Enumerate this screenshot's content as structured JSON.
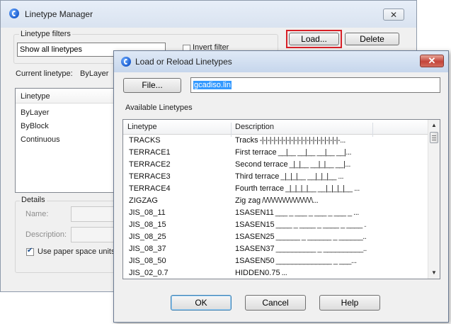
{
  "manager": {
    "title": "Linetype Manager",
    "close_glyph": "✕",
    "filters_label": "Linetype filters",
    "filter_value": "Show all linetypes",
    "invert_label": "Invert filter",
    "load_label": "Load...",
    "delete_label": "Delete",
    "current_label": "Current linetype:",
    "current_value": "ByLayer",
    "list_header": "Linetype",
    "list_items": [
      "ByLayer",
      "ByBlock",
      "Continuous"
    ],
    "details_label": "Details",
    "name_label": "Name:",
    "description_label": "Description:",
    "paper_space_label": "Use paper space units"
  },
  "dialog": {
    "title": "Load or Reload Linetypes",
    "close_glyph": "✕",
    "file_button": "File...",
    "file_value": "gcadiso.lin",
    "available_label": "Available Linetypes",
    "col_linetype": "Linetype",
    "col_description": "Description",
    "rows": [
      {
        "name": "TRACKS",
        "desc": "Tracks",
        "sample": "-|-|-|-|-|-|-|-|-|-|-|-|-|-|-|-|-|-|-|-|-..."
      },
      {
        "name": "TERRACE1",
        "desc": "First terrace",
        "sample": "__|__  __|__  __|__  __|..."
      },
      {
        "name": "TERRACE2",
        "desc": "Second terrace",
        "sample": "_|_|__  __|_|__  __|..."
      },
      {
        "name": "TERRACE3",
        "desc": "Third terrace",
        "sample": "_|_|_|__  __|_|_|__  ..."
      },
      {
        "name": "TERRACE4",
        "desc": "Fourth terrace",
        "sample": "_|_|_|_|__  __|_|_|_|__ ..."
      },
      {
        "name": "ZIGZAG",
        "desc": "Zig zag",
        "sample": "/\\/\\/\\/\\/\\/\\/\\/\\/\\/\\/\\/\\/\\/\\..."
      },
      {
        "name": "JIS_08_11",
        "desc": "1SASEN11",
        "sample": "___ _ ___ _ ___ _ ___ _ ..."
      },
      {
        "name": "JIS_08_15",
        "desc": "1SASEN15",
        "sample": "____ _ ____ _ ____ _ ____ ..."
      },
      {
        "name": "JIS_08_25",
        "desc": "1SASEN25",
        "sample": "______ _ ______ _ ______..."
      },
      {
        "name": "JIS_08_37",
        "desc": "1SASEN37",
        "sample": "__________ _ __________..."
      },
      {
        "name": "JIS_08_50",
        "desc": "1SASEN50",
        "sample": "______________ _ ___..."
      },
      {
        "name": "JIS_02_0.7",
        "desc": "HIDDEN0.75",
        "sample": "..."
      }
    ],
    "ok_label": "OK",
    "cancel_label": "Cancel",
    "help_label": "Help",
    "scroll_up": "▲",
    "scroll_down": "▼"
  }
}
